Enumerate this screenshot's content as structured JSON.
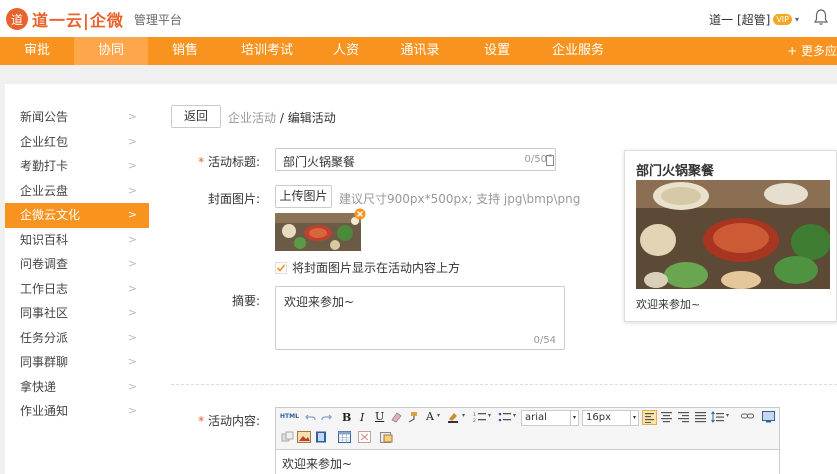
{
  "header": {
    "logo_mark": "道",
    "logo_text": "道一云|企微",
    "logo_subtitle": "管理平台",
    "user_name": "道一 [超管]",
    "vip_badge": "VIP",
    "caret": "▾"
  },
  "nav": {
    "items": [
      {
        "label": "审批"
      },
      {
        "label": "协同"
      },
      {
        "label": "销售"
      },
      {
        "label": "培训考试"
      },
      {
        "label": "人资"
      },
      {
        "label": "通讯录"
      },
      {
        "label": "设置"
      },
      {
        "label": "企业服务"
      }
    ],
    "more": "+ 更多应"
  },
  "sidebar": {
    "arrow": ">",
    "items": [
      {
        "label": "新闻公告"
      },
      {
        "label": "企业红包"
      },
      {
        "label": "考勤打卡"
      },
      {
        "label": "企业云盘"
      },
      {
        "label": "企微云文化"
      },
      {
        "label": "知识百科"
      },
      {
        "label": "问卷调查"
      },
      {
        "label": "工作日志"
      },
      {
        "label": "同事社区"
      },
      {
        "label": "任务分派"
      },
      {
        "label": "同事群聊"
      },
      {
        "label": "拿快递"
      },
      {
        "label": "作业通知"
      }
    ]
  },
  "page": {
    "back_button": "返回",
    "breadcrumb_parent": "企业活动",
    "breadcrumb_sep": " / ",
    "breadcrumb_current": "编辑活动",
    "required_mark": "*",
    "title_label": "活动标题:",
    "title_value": "部门火锅聚餐",
    "title_count": "0/50",
    "cover_label": "封面图片:",
    "upload_button": "上传图片",
    "upload_hint": "建议尺寸900px*500px; 支持 jpg\\bmp\\png",
    "cover_checkbox_label": "将封面图片显示在活动内容上方",
    "summary_label": "摘要:",
    "summary_value": "欢迎来参加~",
    "summary_count": "0/54",
    "content_label": "活动内容:",
    "editor_content": "欢迎来参加~"
  },
  "preview": {
    "title": "部门火锅聚餐",
    "summary": "欢迎来参加~"
  },
  "editor_toolbar": {
    "font_family": "arial",
    "font_size": "16px",
    "html_label": "HTML",
    "dropdown_arrow": "▾"
  },
  "colors": {
    "primary_orange": "#f7931e",
    "active_nav": "#fda64b",
    "logo_orange": "#e8622c",
    "required_red": "#f25c2b"
  }
}
